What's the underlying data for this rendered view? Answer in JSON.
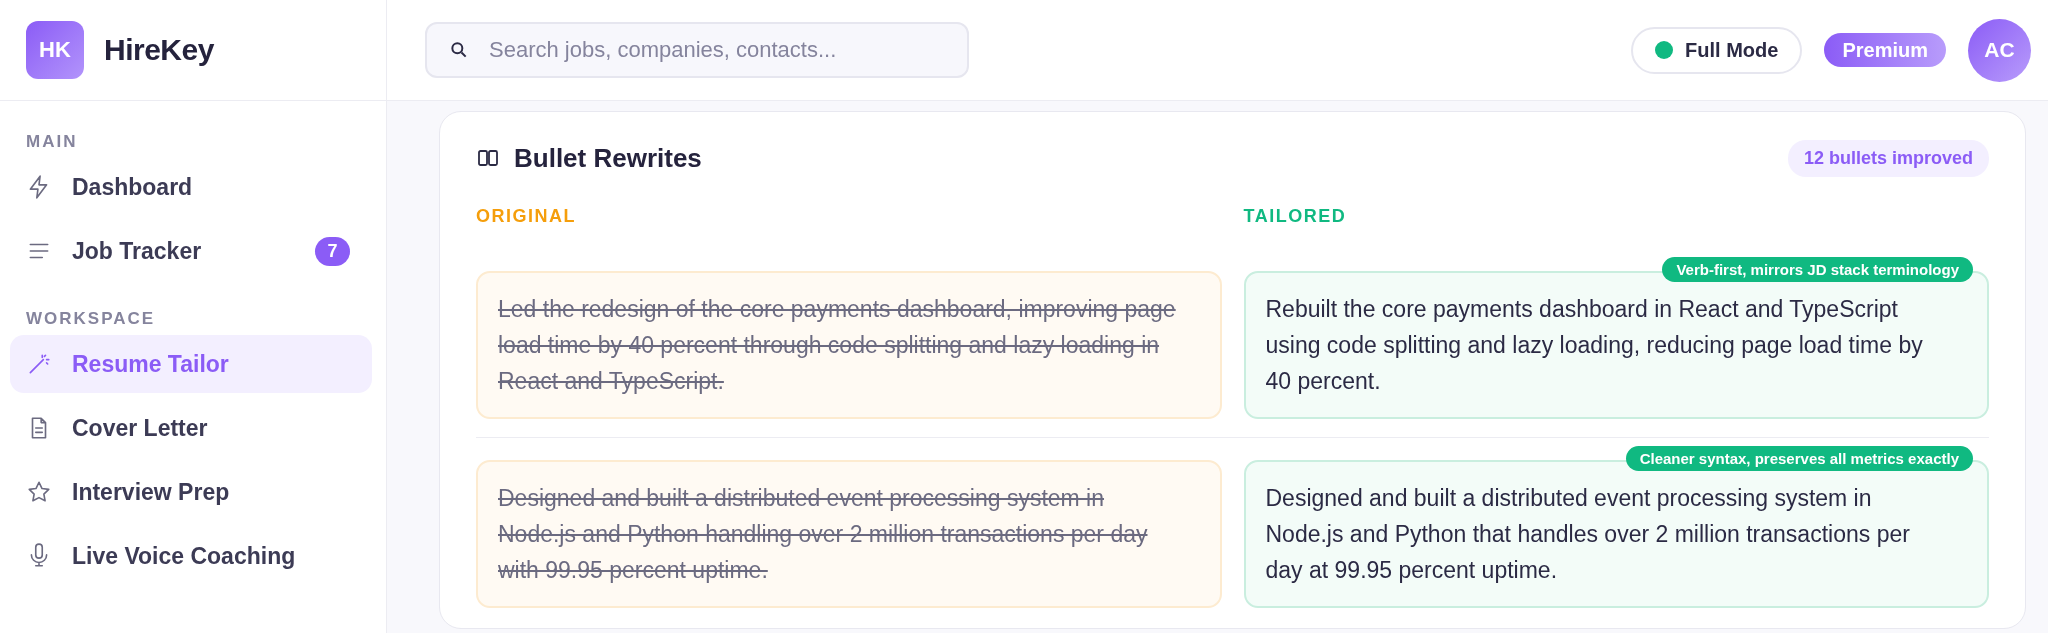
{
  "brand": {
    "logo": "HK",
    "name": "HireKey"
  },
  "sidebar": {
    "sections": [
      {
        "title": "MAIN",
        "items": [
          {
            "label": "Dashboard",
            "selected": false
          },
          {
            "label": "Job Tracker",
            "badge": "7",
            "selected": false
          }
        ]
      },
      {
        "title": "WORKSPACE",
        "items": [
          {
            "label": "Resume Tailor",
            "selected": true
          },
          {
            "label": "Cover Letter",
            "selected": false
          },
          {
            "label": "Interview Prep",
            "selected": false
          },
          {
            "label": "Live Voice Coaching",
            "selected": false
          }
        ]
      }
    ]
  },
  "topbar": {
    "search": {
      "placeholder": "Search jobs, companies, contacts..."
    },
    "mode": {
      "label": "Full Mode",
      "on": true
    },
    "plan": "Premium",
    "avatar": "AC"
  },
  "card": {
    "title": "Bullet Rewrites",
    "count": "12 bullets improved",
    "original_label": "ORIGINAL",
    "tailored_label": "TAILORED",
    "rows": [
      {
        "original": "Led the redesign of the core payments dashboard, improving page load time by 40 percent through code splitting and lazy loading in React and TypeScript.",
        "tailored": "Rebuilt the core payments dashboard in React and TypeScript using code splitting and lazy loading, reducing page load time by 40 percent.",
        "note": "Verb-first, mirrors JD stack terminology"
      },
      {
        "original": "Designed and built a distributed event processing system in Node.js and Python handling over 2 million transactions per day with 99.95 percent uptime.",
        "tailored": "Designed and built a distributed event processing system in Node.js and Python that handles over 2 million transactions per day at 99.95 percent uptime.",
        "note": "Cleaner syntax, preserves all metrics exactly"
      }
    ]
  }
}
